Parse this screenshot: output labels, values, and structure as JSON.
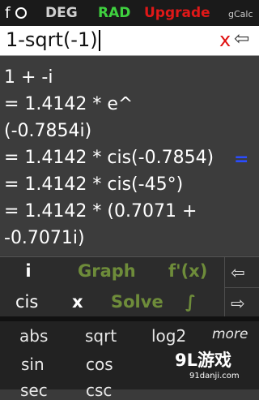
{
  "topbar": {
    "f_label": "f",
    "deg": "DEG",
    "rad": "RAD",
    "upgrade": "Upgrade",
    "app_name": "gCalc"
  },
  "input": {
    "expression": "1-sqrt(-1",
    "after_caret": ")",
    "clear": "x",
    "backspace": "⇦"
  },
  "results": [
    "1 + -i",
    "= 1.4142 * e^",
    "(-0.7854i)",
    "= 1.4142 * cis(-0.7854)",
    "= 1.4142 * cis(-45°)",
    "= 1.4142 * (0.7071 +",
    "-0.7071i)"
  ],
  "equals_mark": "=",
  "function_keys": {
    "i": "i",
    "graph": "Graph",
    "fprime": "f'(x)",
    "left_arrow": "⇦",
    "cis": "cis",
    "times": "x",
    "solve": "Solve",
    "integral": "∫",
    "right_arrow": "⇨"
  },
  "keypad": {
    "row1": [
      "abs",
      "sqrt",
      "log2",
      "more"
    ],
    "row2": [
      "sin",
      "cos"
    ],
    "row3": [
      "sec",
      "csc"
    ]
  },
  "watermark": {
    "main": "9L游戏",
    "sub": "91danji.com"
  },
  "colors": {
    "rad_active": "#3fd13f",
    "upgrade": "#e01818",
    "function_green": "#6e8c3a",
    "equals_blue": "#2a4cff"
  }
}
